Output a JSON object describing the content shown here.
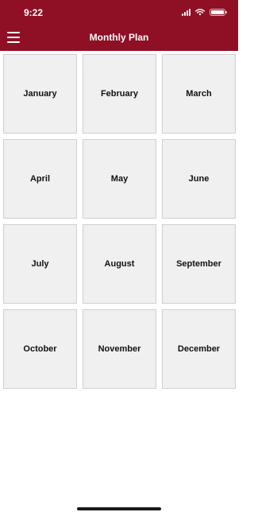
{
  "status_bar": {
    "time": "9:22"
  },
  "header": {
    "title": "Monthly Plan",
    "background_color": "#8f0f24",
    "menu_icon": "hamburger-menu-icon"
  },
  "months": [
    "January",
    "February",
    "March",
    "April",
    "May",
    "June",
    "July",
    "August",
    "September",
    "October",
    "November",
    "December"
  ]
}
